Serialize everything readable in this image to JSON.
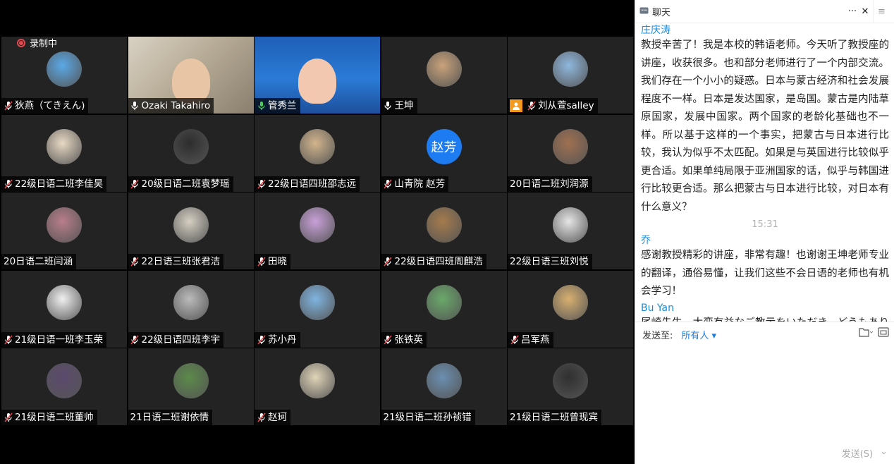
{
  "recording": {
    "label": "录制中"
  },
  "participants": [
    {
      "name": "狄燕（てきえん)",
      "muted": true,
      "avatar": "skier-icon"
    },
    {
      "name": "Ozaki Takahiro",
      "muted": false,
      "video": true
    },
    {
      "name": "管秀兰",
      "muted": false,
      "video": true,
      "speaking": true
    },
    {
      "name": "王坤",
      "muted": false,
      "avatar": "baby-icon"
    },
    {
      "name": "刘从萱salley",
      "muted": true,
      "avatar": "person-icon",
      "host_badge": true
    },
    {
      "name": "22级日语二班李佳昊",
      "muted": true,
      "avatar": "logo-icon"
    },
    {
      "name": "20级日语二班袁梦瑶",
      "muted": true,
      "avatar": "girl-icon"
    },
    {
      "name": "22级日语四班邵志远",
      "muted": true,
      "avatar": "anime-icon"
    },
    {
      "name": "山青院 赵芳",
      "muted": true,
      "avatar_text": "赵芳"
    },
    {
      "name": "20日语二班刘润源",
      "muted": null,
      "avatar": "portrait-icon"
    },
    {
      "name": "20日语二班闫涵",
      "muted": null,
      "avatar": "anime-girl-icon"
    },
    {
      "name": "22日语三班张君洁",
      "muted": true,
      "avatar": "man-icon"
    },
    {
      "name": "田晓",
      "muted": true,
      "avatar": "anime-pink-icon"
    },
    {
      "name": "22级日语四班周麒浩",
      "muted": true,
      "avatar": "dog-icon"
    },
    {
      "name": "22级日语三班刘悦",
      "muted": null,
      "avatar": "cartoon-icon"
    },
    {
      "name": "21级日语一班李玉荣",
      "muted": true,
      "avatar": "kuromi-icon"
    },
    {
      "name": "22级日语四班李宇",
      "muted": true,
      "avatar": "sketch-icon"
    },
    {
      "name": "苏小丹",
      "muted": true,
      "avatar": "landscape-icon"
    },
    {
      "name": "张铁英",
      "muted": true,
      "avatar": "building-icon"
    },
    {
      "name": "吕军燕",
      "muted": true,
      "avatar": "person2-icon"
    },
    {
      "name": "21级日语二班董帅",
      "muted": true,
      "avatar": "doll-icon"
    },
    {
      "name": "21日语二班谢依情",
      "muted": null,
      "avatar": "girl2-icon"
    },
    {
      "name": "赵珂",
      "muted": true,
      "avatar": "deer-icon"
    },
    {
      "name": "21级日语二班孙祯错",
      "muted": null,
      "avatar": "musician-icon"
    },
    {
      "name": "21级日语二班曾现宾",
      "muted": null,
      "avatar": "astronaut-icon"
    }
  ],
  "chat": {
    "title": "聊天",
    "controls": {
      "more": "···",
      "close": "✕",
      "side": "≡"
    },
    "messages": [
      {
        "sender": "庄庆涛",
        "text": "教授辛苦了！我是本校的韩语老师。今天听了教授座的讲座，收获很多。也和部分老师进行了一个内部交流。我们存在一个小小的疑惑。日本与蒙古经济和社会发展程度不一样。日本是发达国家，是岛国。蒙古是内陆草原国家，发展中国家。两个国家的老龄化基础也不一样。所以基于这样的一个事实，把蒙古与日本进行比较，我认为似乎不太匹配。如果是与英国进行比较似乎更合适。如果单纯局限于亚洲国家的话，似乎与韩国进行比较更合适。那么把蒙古与日本进行比较，对日本有什么意义？"
      },
      {
        "time": "15:31"
      },
      {
        "sender": "乔",
        "text": "感谢教授精彩的讲座，非常有趣！也谢谢王坤老师专业的翻译，通俗易懂，让我们这些不会日语的老师也有机会学习！"
      },
      {
        "sender": "Bu Yan",
        "text": "尾崎先生、大変有益なご教示をいただき、どうもありがとうございました。"
      }
    ],
    "send_to_label": "发送至:",
    "send_to_target": "所有人",
    "send_button": "发送(S)"
  },
  "colors": {
    "accent": "#1a8cd8",
    "speaking": "#4ccf5a",
    "record": "#e5484d"
  }
}
